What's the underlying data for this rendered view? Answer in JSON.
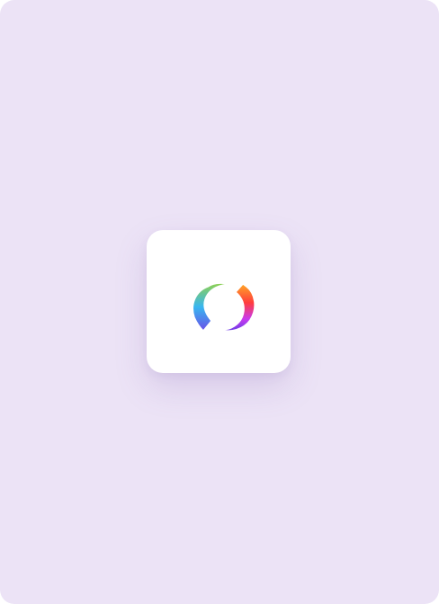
{
  "theme": {
    "background": "#ECE3F6",
    "tile_background": "#FFFFFF"
  },
  "app_icon": {
    "icon": "sync-logo-icon",
    "gradient_left": [
      "#8FD14F",
      "#38B6F0",
      "#6A4FE8"
    ],
    "gradient_right": [
      "#FFA826",
      "#FF3D3D",
      "#C83AF0",
      "#6A3DE6"
    ]
  }
}
